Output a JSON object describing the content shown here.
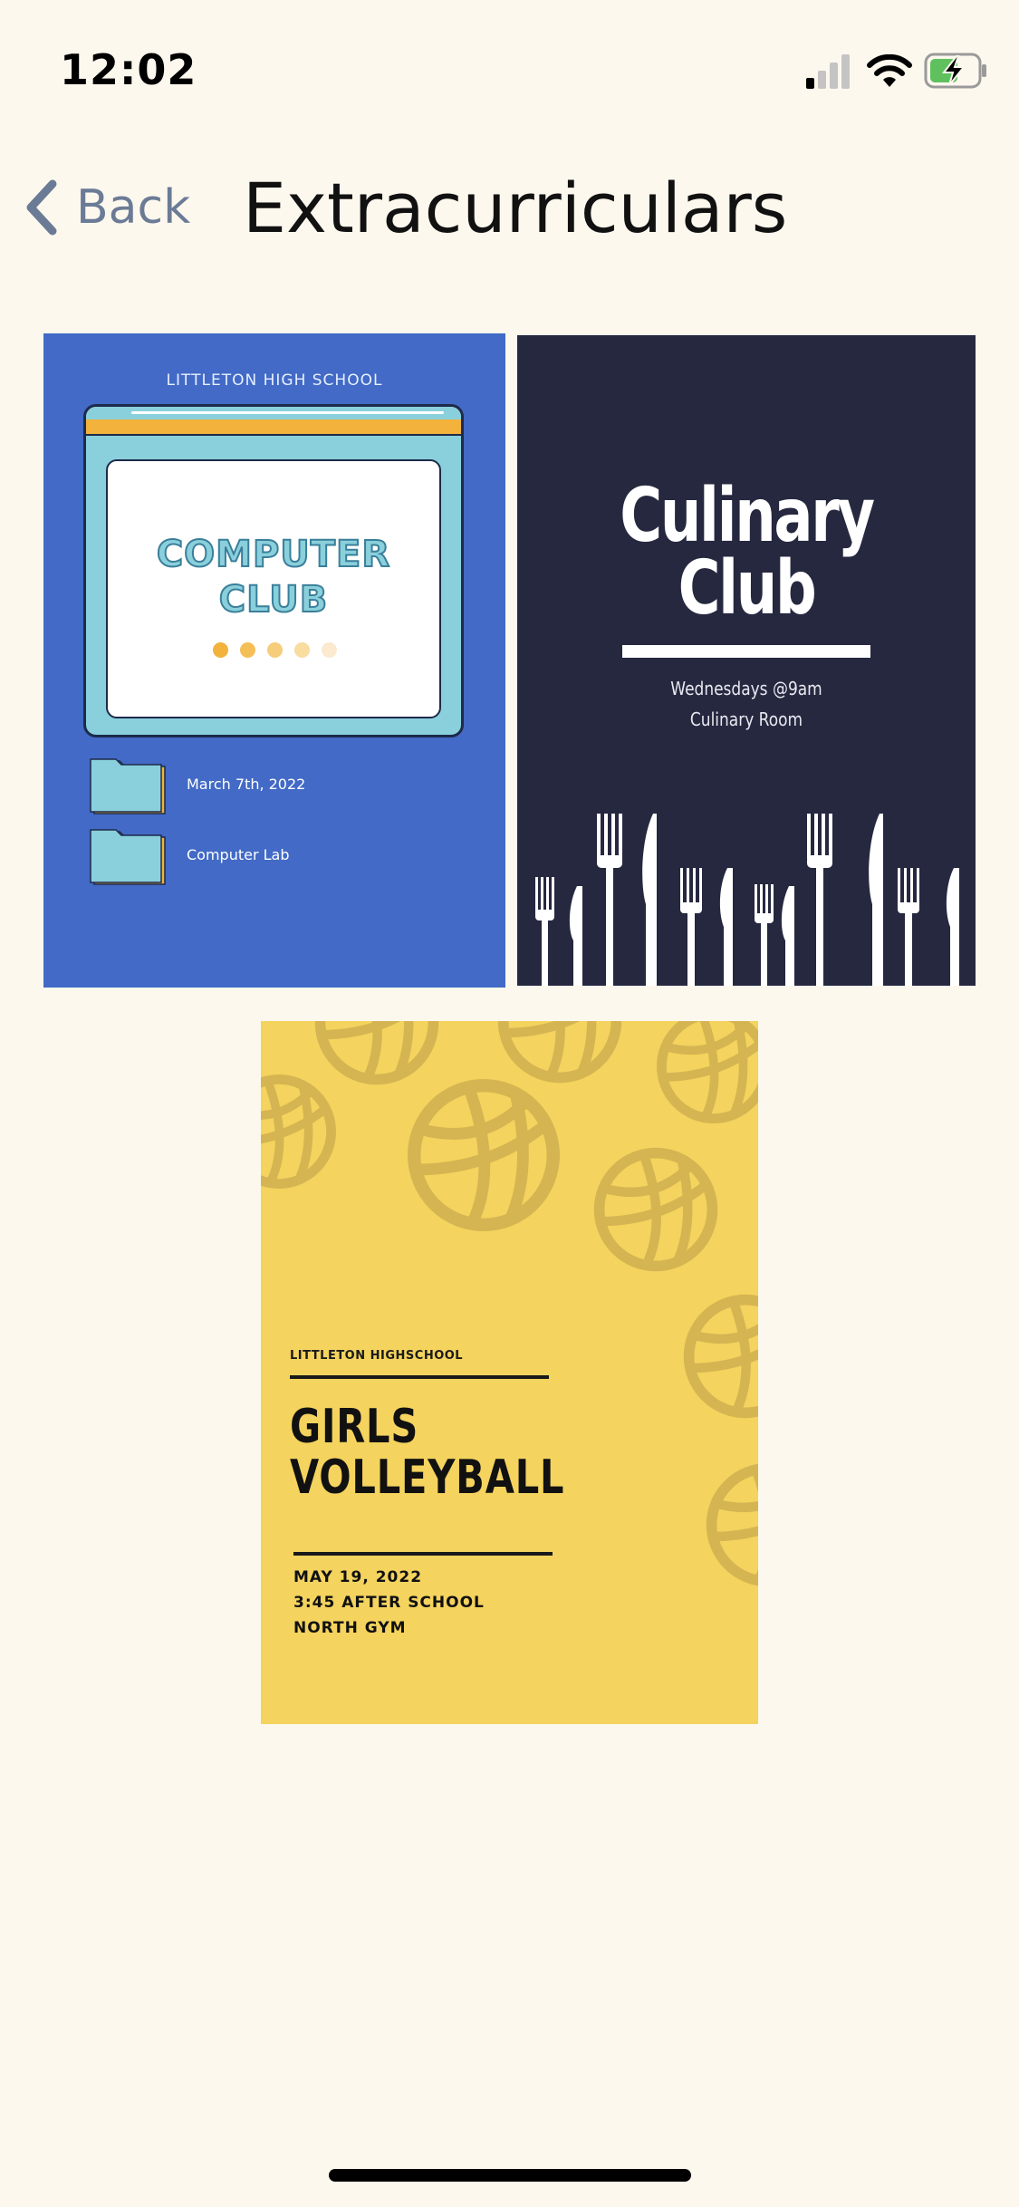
{
  "status_bar": {
    "time": "12:02"
  },
  "nav": {
    "back_label": "Back",
    "title": "Extracurriculars"
  },
  "posters": {
    "computer": {
      "school": "LITTLETON HIGH SCHOOL",
      "title_line1": "COMPUTER",
      "title_line2": "CLUB",
      "date": "March 7th, 2022",
      "location": "Computer Lab",
      "colors": {
        "background": "#426ac6",
        "window": "#8ad0dc",
        "accent": "#f2b23c"
      }
    },
    "culinary": {
      "title_line1": "Culinary",
      "title_line2": "Club",
      "schedule": "Wednesdays @9am",
      "location": "Culinary Room",
      "colors": {
        "background": "#262840",
        "text": "#ffffff"
      }
    },
    "volleyball": {
      "school": "LITTLETON HIGHSCHOOL",
      "title_line1": "GIRLS",
      "title_line2": "VOLLEYBALL",
      "date": "MAY 19, 2022",
      "time": "3:45 AFTER SCHOOL",
      "location": "NORTH GYM",
      "colors": {
        "background": "#f4d35e",
        "balls": "#d5b552"
      }
    }
  }
}
